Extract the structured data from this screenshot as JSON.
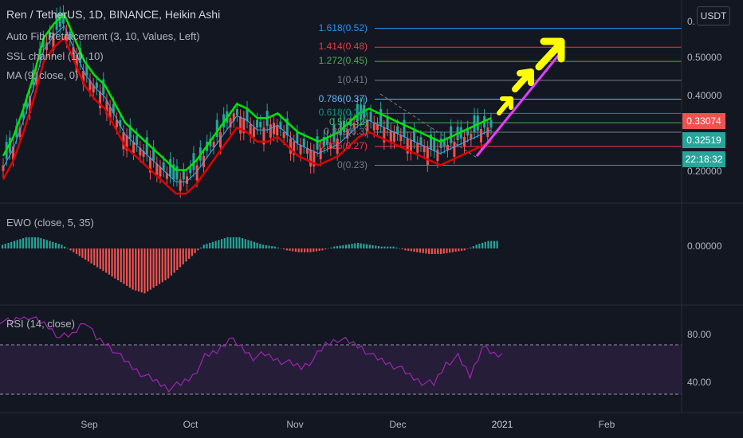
{
  "header": {
    "symbol_title": "Ren / TetherUS, 1D, BINANCE, Heikin Ashi",
    "indicators": [
      "Auto Fib Retracement (3, 10, Values, Left)",
      "SSL channel (10, 10)",
      "MA (9, close, 0)"
    ]
  },
  "currency_button": "USDT",
  "price_axis": {
    "ticks": [
      "0.",
      "0.50000",
      "0.40000",
      "0.30000",
      "0.20000"
    ],
    "tags": [
      {
        "text": "0.33074",
        "color": "#ef5350"
      },
      {
        "text": "0.32519",
        "color": "#26a69a"
      },
      {
        "text": "22:18:32",
        "color": "#26a69a"
      }
    ]
  },
  "fib_levels": [
    {
      "label": "1.618(0.52)",
      "color": "#2196f3"
    },
    {
      "label": "1.414(0.48)",
      "color": "#f23645"
    },
    {
      "label": "1.272(0.45)",
      "color": "#4caf50"
    },
    {
      "label": "1(0.41)",
      "color": "#787b86"
    },
    {
      "label": "0.786(0.37)",
      "color": "#64b5f6"
    },
    {
      "label": "0.618(0.34)",
      "color": "#089981"
    },
    {
      "label": "0.5(0.32)",
      "color": "#4caf50"
    },
    {
      "label": "0.382(0.3)",
      "color": "#787b86"
    },
    {
      "label": "0.236(0.27)",
      "color": "#f23645"
    },
    {
      "label": "0(0.23)",
      "color": "#787b86"
    }
  ],
  "ewo_panel": {
    "title": "EWO (close, 5, 35)",
    "axis": "0.00000"
  },
  "rsi_panel": {
    "title": "RSI (14, close)",
    "ticks": [
      "80.00",
      "40.00"
    ]
  },
  "time_axis": {
    "labels": [
      "Sep",
      "Oct",
      "Nov",
      "Dec",
      "2021",
      "Feb"
    ]
  },
  "colors": {
    "background": "#131722",
    "up": "#26a69a",
    "down": "#ef5350",
    "ssl_up": "#00e600",
    "ssl_down": "#e00000",
    "ma": "#42a5f5",
    "rsi": "#9c27b0",
    "arrow": "#ffff00",
    "trendline": "#e040fb"
  },
  "chart_data": [
    {
      "type": "line",
      "title": "Ren / TetherUS, 1D, BINANCE, Heikin Ashi",
      "series": [
        {
          "name": "SSL channel (10, 10)",
          "values_upper": [
            0.25,
            0.29,
            0.35,
            0.42,
            0.5,
            0.53,
            0.55,
            0.5,
            0.45,
            0.42,
            0.4,
            0.36,
            0.32,
            0.3,
            0.28,
            0.26,
            0.24,
            0.22,
            0.22,
            0.24,
            0.27,
            0.3,
            0.33,
            0.36,
            0.35,
            0.33,
            0.33,
            0.34,
            0.32,
            0.3,
            0.29,
            0.28,
            0.29,
            0.3,
            0.32,
            0.34,
            0.35,
            0.34,
            0.33,
            0.32,
            0.31,
            0.3,
            0.29,
            0.28,
            0.29,
            0.3,
            0.31,
            0.32,
            0.33
          ]
        },
        {
          "name": "MA (9, close, 0)"
        }
      ],
      "x_labels": [
        "Sep",
        "Oct",
        "Nov",
        "Dec",
        "2021",
        "Feb"
      ],
      "ylim": [
        0.15,
        0.58
      ],
      "current_price": 0.32519,
      "fib_retracement": {
        "0": 0.23,
        "0.236": 0.27,
        "0.382": 0.3,
        "0.5": 0.32,
        "0.618": 0.34,
        "0.786": 0.37,
        "1": 0.41,
        "1.272": 0.45,
        "1.414": 0.48,
        "1.618": 0.52
      }
    },
    {
      "type": "bar",
      "title": "EWO (close, 5, 35)",
      "values": [
        0.01,
        0.02,
        0.03,
        0.03,
        0.02,
        0.01,
        -0.01,
        -0.03,
        -0.05,
        -0.07,
        -0.09,
        -0.11,
        -0.12,
        -0.1,
        -0.08,
        -0.05,
        -0.02,
        0.01,
        0.02,
        0.03,
        0.03,
        0.02,
        0.01,
        0.005,
        -0.005,
        -0.01,
        -0.01,
        -0.005,
        0.005,
        0.01,
        0.015,
        0.01,
        0.005,
        0.005,
        -0.005,
        -0.01,
        -0.015,
        -0.015,
        -0.01,
        -0.005,
        0.01,
        0.02
      ]
    },
    {
      "type": "line",
      "title": "RSI (14, close)",
      "ylim": [
        20,
        100
      ],
      "reference_levels": [
        70,
        30
      ],
      "values": [
        90,
        88,
        95,
        90,
        85,
        76,
        78,
        90,
        75,
        70,
        60,
        52,
        45,
        40,
        35,
        38,
        45,
        60,
        65,
        75,
        68,
        60,
        62,
        58,
        55,
        52,
        58,
        70,
        75,
        72,
        68,
        60,
        56,
        52,
        45,
        40,
        38,
        55,
        60,
        45,
        68,
        62
      ]
    }
  ]
}
